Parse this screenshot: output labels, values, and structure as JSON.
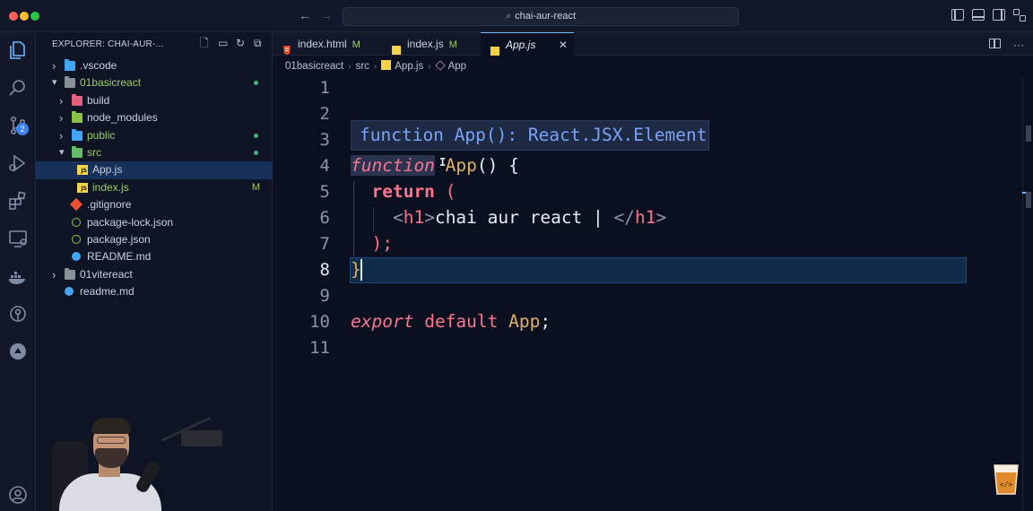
{
  "window": {
    "search_text": "chai-aur-react"
  },
  "activity_bar": {
    "items": [
      "explorer-icon",
      "search-icon",
      "source-control-icon",
      "run-debug-icon",
      "extensions-icon",
      "remote-explorer-icon",
      "docker-icon",
      "gitlens-icon",
      "live-share-icon"
    ],
    "source_control_badge": "2"
  },
  "sidebar": {
    "title": "EXPLORER: CHAI-AUR-...",
    "tree": [
      {
        "label": ".vscode",
        "kind": "folder",
        "depth": 0,
        "expanded": false
      },
      {
        "label": "01basicreact",
        "kind": "folder",
        "depth": 0,
        "expanded": true,
        "status": "dot"
      },
      {
        "label": "build",
        "kind": "folder",
        "depth": 1,
        "expanded": false
      },
      {
        "label": "node_modules",
        "kind": "folder",
        "depth": 1,
        "expanded": false
      },
      {
        "label": "public",
        "kind": "folder",
        "depth": 1,
        "expanded": false,
        "status": "dot"
      },
      {
        "label": "src",
        "kind": "folder",
        "depth": 1,
        "expanded": true,
        "status": "dot"
      },
      {
        "label": "App.js",
        "kind": "js",
        "depth": 2,
        "selected": true
      },
      {
        "label": "index.js",
        "kind": "js",
        "depth": 2,
        "status": "M"
      },
      {
        "label": ".gitignore",
        "kind": "git",
        "depth": 1
      },
      {
        "label": "package-lock.json",
        "kind": "json",
        "depth": 1
      },
      {
        "label": "package.json",
        "kind": "json",
        "depth": 1
      },
      {
        "label": "README.md",
        "kind": "info",
        "depth": 1
      },
      {
        "label": "01vitereact",
        "kind": "folder",
        "depth": 0,
        "expanded": false
      },
      {
        "label": "readme.md",
        "kind": "info",
        "depth": 0
      }
    ]
  },
  "tabs": [
    {
      "label": "index.html",
      "badge": "M",
      "kind": "html"
    },
    {
      "label": "index.js",
      "badge": "M",
      "kind": "js"
    },
    {
      "label": "App.js",
      "badge": "",
      "kind": "js",
      "active": true,
      "close": "✕"
    }
  ],
  "breadcrumb": {
    "parts": [
      "01basicreact",
      "src",
      "App.js",
      "App"
    ]
  },
  "editor": {
    "line_numbers": [
      "1",
      "2",
      "3",
      "4",
      "5",
      "6",
      "7",
      "8",
      "9",
      "10",
      "11"
    ],
    "current_line": "8",
    "hover_hint": {
      "keyword": "function",
      "name": "App",
      "rest": "(): React.JSX.Element"
    },
    "code": {
      "l4_kw": "function",
      "l4_name": "App",
      "l4_rest": "() {",
      "l5_kw": "return",
      "l5_rest": " (",
      "l6_open": "<",
      "l6_tag": "h1",
      "l6_close": ">",
      "l6_text": "chai aur react | ",
      "l6_end_open": "</",
      "l6_end_tag": "h1",
      "l6_end_close": ">",
      "l7": ");",
      "l8": "}",
      "l10_kw1": "export",
      "l10_kw2": "default",
      "l10_name": "App",
      "l10_end": ";"
    }
  },
  "colors": {
    "accent": "#6fb6ff",
    "modified": "#9ece6a",
    "keyword": "#f7768e",
    "function": "#e0af68"
  }
}
